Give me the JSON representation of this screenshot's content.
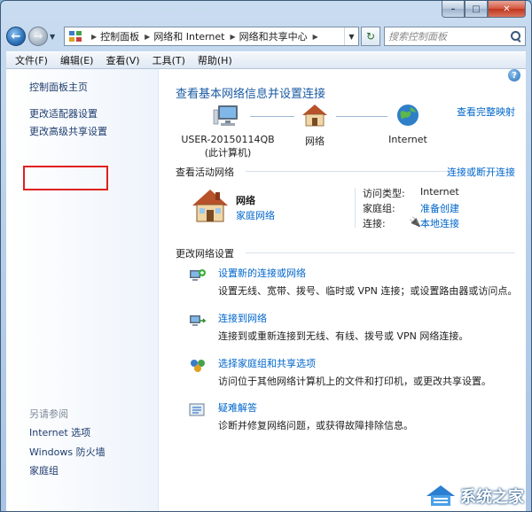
{
  "window": {
    "caption": {
      "minimize": "–",
      "maximize": "□",
      "close": "✕"
    }
  },
  "nav": {
    "back_icon": "back-arrow-icon",
    "forward_icon": "forward-arrow-icon",
    "breadcrumbs": [
      "控制面板",
      "网络和 Internet",
      "网络和共享中心"
    ],
    "search_placeholder": "搜索控制面板"
  },
  "menu": [
    "文件(F)",
    "编辑(E)",
    "查看(V)",
    "工具(T)",
    "帮助(H)"
  ],
  "sidebar": {
    "links": [
      "控制面板主页",
      "更改适配器设置",
      "更改高级共享设置"
    ],
    "see_also_heading": "另请参阅",
    "see_also": [
      "Internet 选项",
      "Windows 防火墙",
      "家庭组"
    ]
  },
  "main": {
    "title": "查看基本网络信息并设置连接",
    "full_map_link": "查看完整映射",
    "map": {
      "computer_name": "USER-20150114QB",
      "computer_sub": "(此计算机)",
      "network": "网络",
      "internet": "Internet"
    },
    "active_heading": "查看活动网络",
    "connect_link": "连接或断开连接",
    "active": {
      "name": "网络",
      "type": "家庭网络",
      "access_label": "访问类型:",
      "access_value": "Internet",
      "homegroup_label": "家庭组:",
      "homegroup_value": "准备创建",
      "connection_label": "连接:",
      "connection_value": "本地连接"
    },
    "change_heading": "更改网络设置",
    "tasks": [
      {
        "title": "设置新的连接或网络",
        "desc": "设置无线、宽带、拨号、临时或 VPN 连接；或设置路由器或访问点。"
      },
      {
        "title": "连接到网络",
        "desc": "连接到或重新连接到无线、有线、拨号或 VPN 网络连接。"
      },
      {
        "title": "选择家庭组和共享选项",
        "desc": "访问位于其他网络计算机上的文件和打印机，或更改共享设置。"
      },
      {
        "title": "疑难解答",
        "desc": "诊断并修复网络问题，或获得故障排除信息。"
      }
    ]
  },
  "watermark": "系统之家",
  "help": "?"
}
